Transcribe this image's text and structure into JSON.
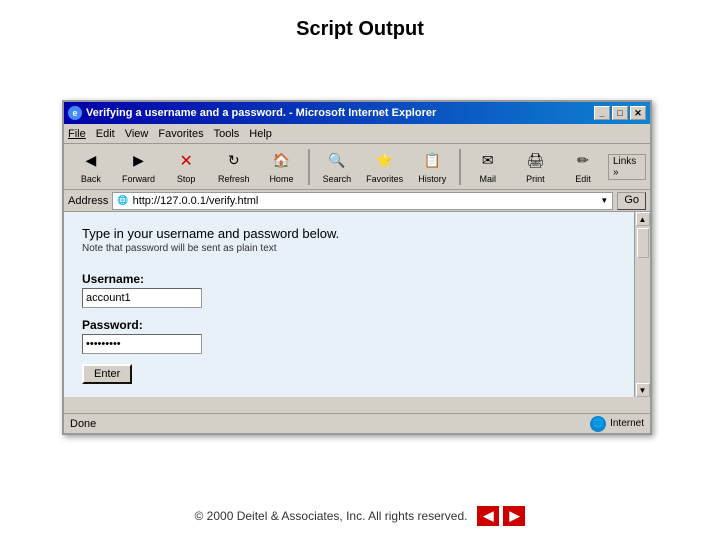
{
  "page": {
    "title": "Script Output"
  },
  "browser": {
    "title_bar": "Verifying a username and a password. - Microsoft Internet Explorer",
    "title_bar_icon": "🌐",
    "minimize": "_",
    "maximize": "□",
    "close": "✕",
    "menus": [
      "File",
      "Edit",
      "View",
      "Favorites",
      "Tools",
      "Help"
    ],
    "toolbar_buttons": [
      {
        "label": "Back",
        "icon": "◀"
      },
      {
        "label": "Forward",
        "icon": "▶"
      },
      {
        "label": "Stop",
        "icon": "✕"
      },
      {
        "label": "Refresh",
        "icon": "↻"
      },
      {
        "label": "Home",
        "icon": "🏠"
      },
      {
        "label": "Search",
        "icon": "🔍"
      },
      {
        "label": "Favorites",
        "icon": "⭐"
      },
      {
        "label": "History",
        "icon": "📋"
      },
      {
        "label": "Mail",
        "icon": "✉"
      },
      {
        "label": "Print",
        "icon": "🖨"
      },
      {
        "label": "Edit",
        "icon": "✏"
      }
    ],
    "address_label": "Address",
    "address_url": "http://127.0.0.1/verify.html",
    "go_label": "Go",
    "links_label": "Links »",
    "content": {
      "heading": "Type in your username and password below.",
      "note": "Note that password will be sent as plain text",
      "username_label": "Username:",
      "username_value": "account1",
      "password_label": "Password:",
      "password_value": "••••••••",
      "enter_button": "Enter"
    },
    "status": {
      "left": "Done",
      "right": "Internet"
    }
  },
  "footer": {
    "copyright": "© 2000 Deitel & Associates, Inc.  All rights reserved.",
    "prev_label": "◀",
    "next_label": "▶"
  }
}
